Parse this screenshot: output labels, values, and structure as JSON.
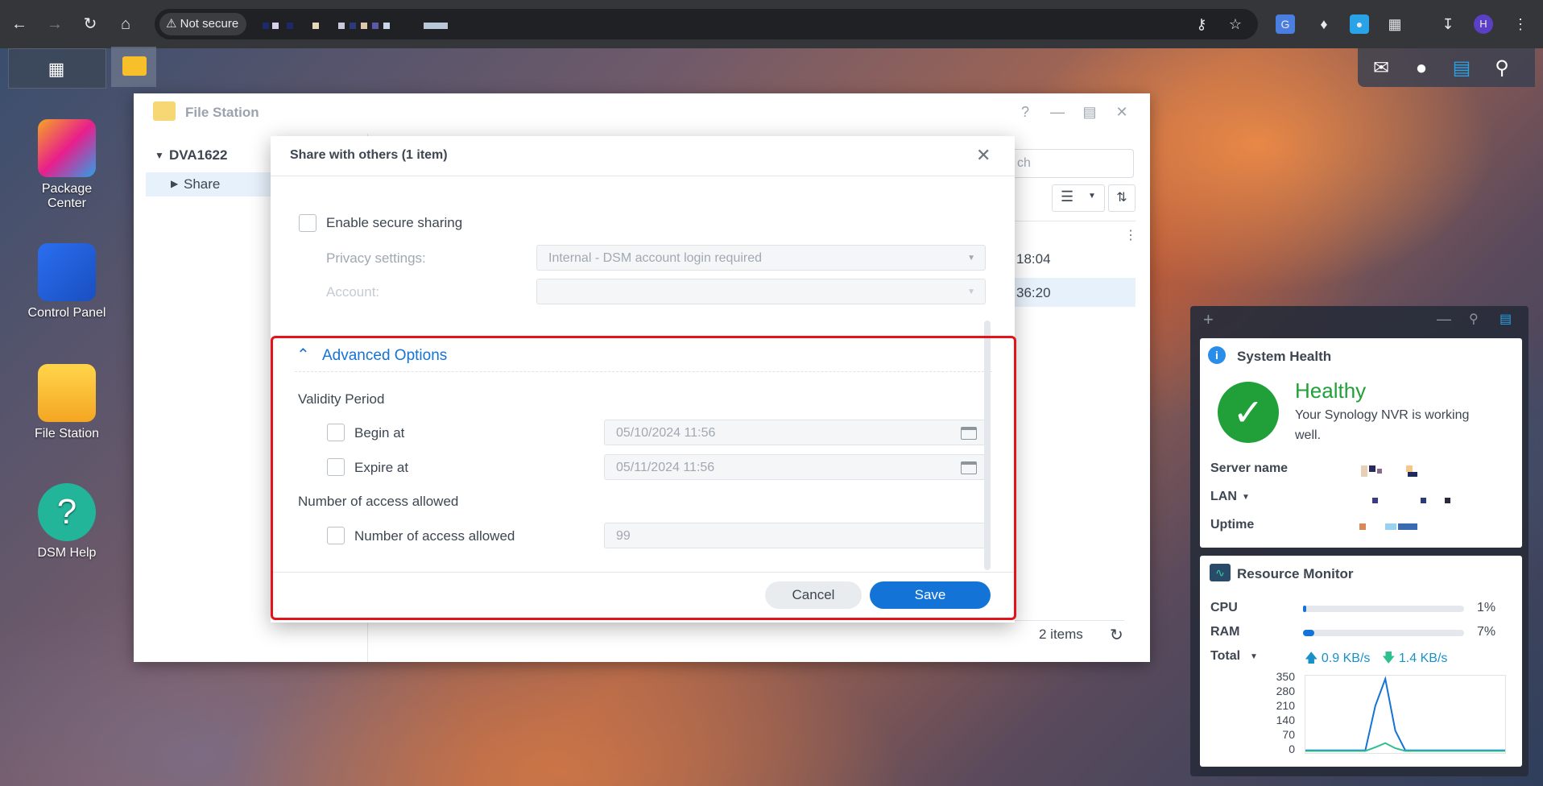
{
  "browser": {
    "security_label": "Not secure"
  },
  "taskbar": {
    "widgets": [
      "chat-icon",
      "user-icon",
      "widget-icon",
      "search-icon"
    ]
  },
  "desktop": {
    "icons": [
      {
        "label_line1": "Package",
        "label_line2": "Center"
      },
      {
        "label_line1": "Control Panel",
        "label_line2": ""
      },
      {
        "label_line1": "File Station",
        "label_line2": ""
      },
      {
        "label_line1": "DSM Help",
        "label_line2": ""
      }
    ]
  },
  "file_station": {
    "title": "File Station",
    "tree_root": "DVA1622",
    "tree_share": "Share",
    "search_placeholder": "ch",
    "row1_time": "18:04",
    "row2_time": "36:20",
    "items_count": "2 items"
  },
  "modal": {
    "title": "Share with others (1 item)",
    "enable_secure_sharing": "Enable secure sharing",
    "privacy_label": "Privacy settings:",
    "privacy_value": "Internal - DSM account login required",
    "account_label": "Account:",
    "account_value": "",
    "advanced_title": "Advanced Options",
    "validity_period": "Validity Period",
    "begin_at_label": "Begin at",
    "begin_at_value": "05/10/2024 11:56",
    "expire_at_label": "Expire at",
    "expire_at_value": "05/11/2024 11:56",
    "access_section": "Number of access allowed",
    "access_label": "Number of access allowed",
    "access_value": "99",
    "cancel": "Cancel",
    "save": "Save"
  },
  "system_health": {
    "title": "System Health",
    "status": "Healthy",
    "message_line1": "Your Synology NVR is working",
    "message_line2": "well.",
    "server_name_label": "Server name",
    "lan_label": "LAN",
    "uptime_label": "Uptime"
  },
  "resource_monitor": {
    "title": "Resource Monitor",
    "cpu_label": "CPU",
    "cpu_pct": "1%",
    "cpu_value": 0.01,
    "ram_label": "RAM",
    "ram_pct": "7%",
    "ram_value": 0.07,
    "total_label": "Total",
    "upload": "0.9 KB/s",
    "download": "1.4 KB/s"
  },
  "chart_data": {
    "type": "line",
    "yticks": [
      "350",
      "280",
      "210",
      "140",
      "70",
      "0"
    ],
    "ylim": [
      0,
      350
    ],
    "series": [
      {
        "color": "#1473d6",
        "values": [
          5,
          5,
          5,
          5,
          5,
          5,
          5,
          220,
          350,
          100,
          5,
          5,
          5,
          5,
          5,
          5,
          5,
          5,
          5,
          5,
          5
        ]
      },
      {
        "color": "#2fbf91",
        "values": [
          2,
          2,
          2,
          2,
          2,
          2,
          2,
          20,
          40,
          15,
          2,
          2,
          2,
          2,
          2,
          2,
          2,
          2,
          2,
          2,
          2
        ]
      }
    ]
  }
}
